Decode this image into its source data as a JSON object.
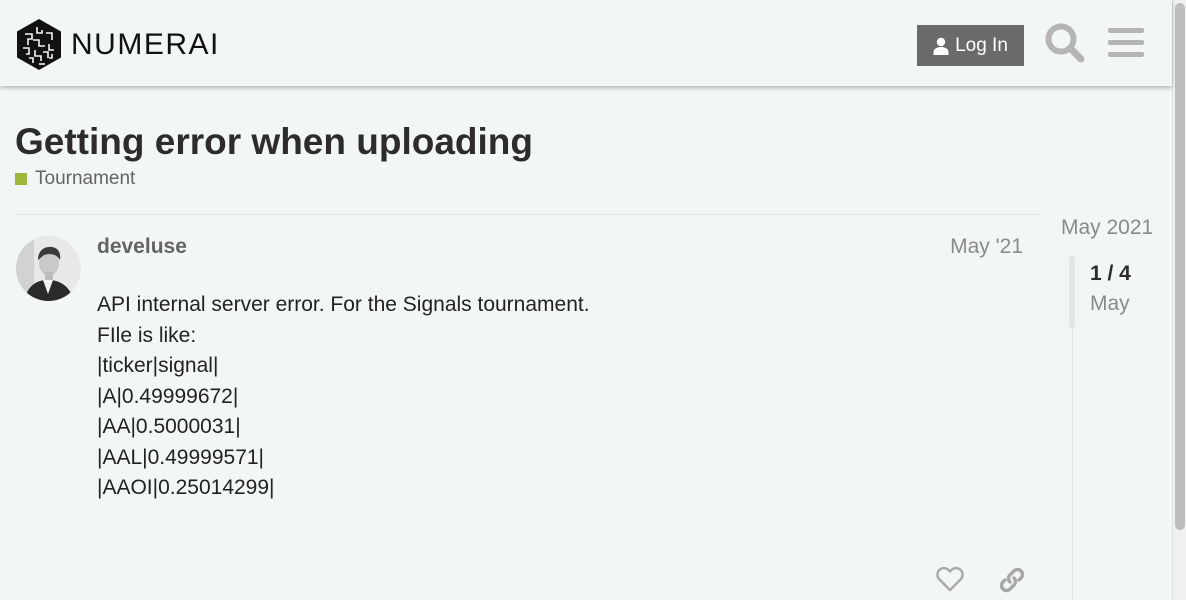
{
  "header": {
    "logo_text": "NUMERAI",
    "login_label": "Log In"
  },
  "topic": {
    "title": "Getting error when uploading",
    "category": "Tournament",
    "category_color": "#9eb83b"
  },
  "post": {
    "username": "develuse",
    "date": "May '21",
    "lines": [
      "API internal server error. For the Signals tournament.",
      "FIle is like:",
      "|ticker|signal|",
      "|A|0.49999672|",
      "|AA|0.5000031|",
      "|AAL|0.49999571|",
      "|AAOI|0.25014299|"
    ]
  },
  "timeline": {
    "start_label": "May 2021",
    "count": "1 / 4",
    "current_date": "May"
  },
  "colors": {
    "background": "#f3f6f7",
    "button": "#6a6a6a",
    "muted_text": "#646464"
  }
}
